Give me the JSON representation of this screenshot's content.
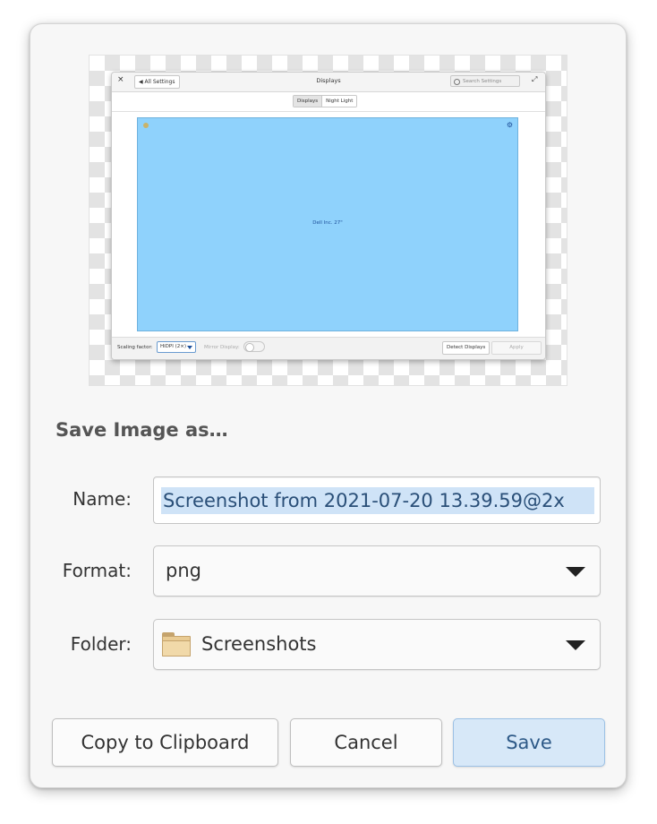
{
  "preview": {
    "window_title": "Displays",
    "close_glyph": "×",
    "back_button": "All Settings",
    "search_placeholder": "Search Settings",
    "maximize_glyph": "⤢",
    "tabs": [
      "Displays",
      "Night Light"
    ],
    "active_tab": "Displays",
    "display_label": "Dell Inc. 27\"",
    "scaling_label": "Scaling factor:",
    "scaling_value": "HiDPI (2×)",
    "mirror_label": "Mirror Display:",
    "detect_button": "Detect Displays",
    "apply_button": "Apply",
    "display_color": "#8fd2fc"
  },
  "dialog": {
    "heading": "Save Image as…",
    "name_label": "Name:",
    "name_value": "Screenshot from 2021-07-20 13.39.59@2x",
    "format_label": "Format:",
    "format_value": "png",
    "folder_label": "Folder:",
    "folder_value": "Screenshots",
    "folder_icon": "folder-icon",
    "dropdown_icon": "triangle-down-icon"
  },
  "buttons": {
    "copy": "Copy to Clipboard",
    "cancel": "Cancel",
    "save": "Save"
  },
  "colors": {
    "accent": "#d7e8f8",
    "selection": "#cfe3f7"
  }
}
